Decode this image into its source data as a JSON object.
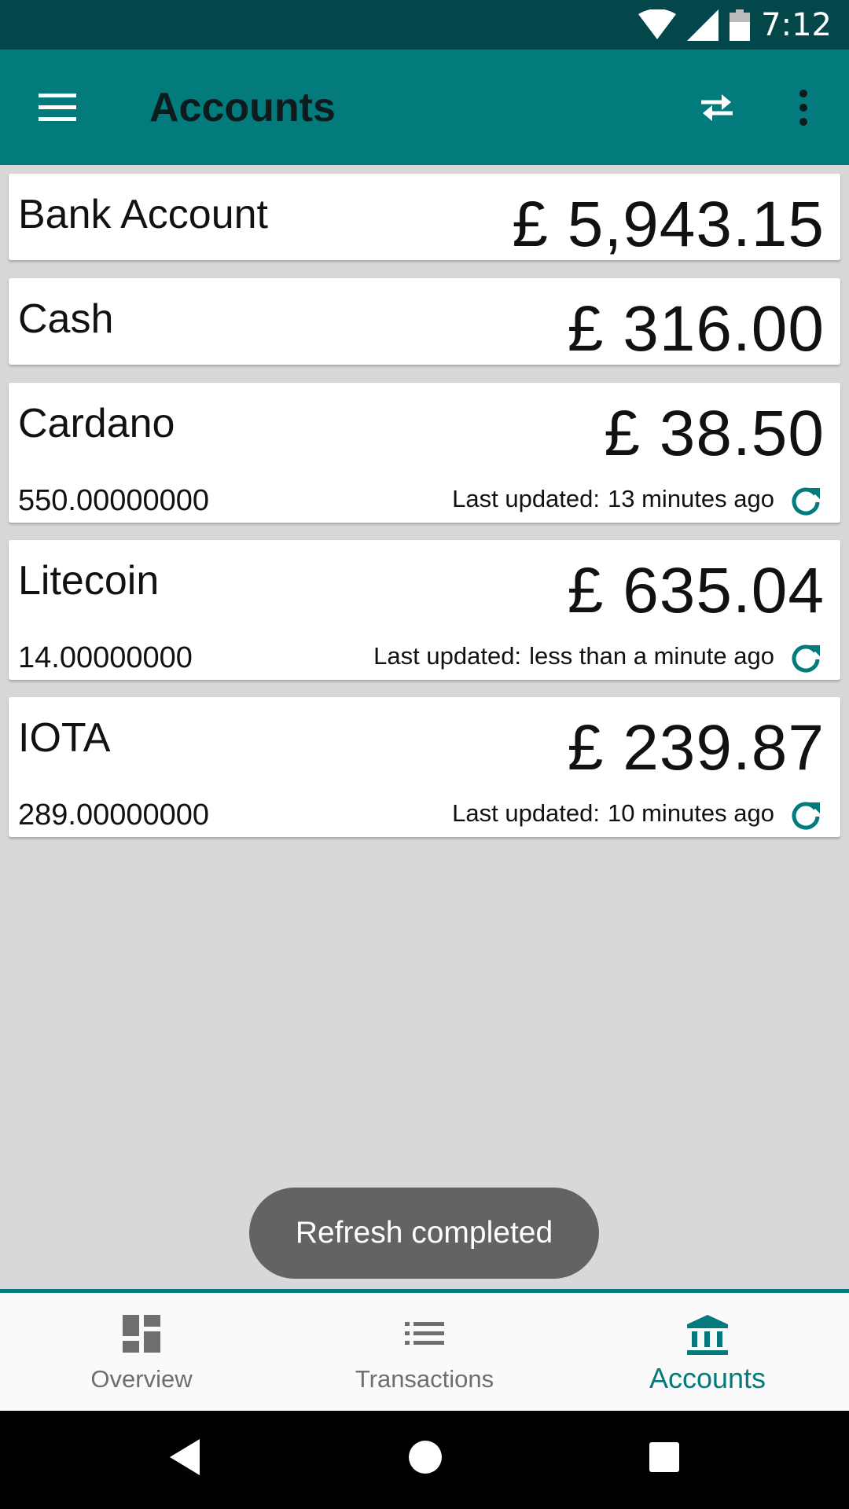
{
  "status_bar": {
    "time": "7:12"
  },
  "app_bar": {
    "title": "Accounts"
  },
  "accounts": [
    {
      "name": "Bank Account",
      "currency_symbol": "£",
      "balance": "5,943.15"
    },
    {
      "name": "Cash",
      "currency_symbol": "£",
      "balance": "316.00"
    },
    {
      "name": "Cardano",
      "currency_symbol": "£",
      "balance": "38.50",
      "quantity": "550.00000000",
      "updated_label": "Last updated:",
      "updated_value": "13 minutes ago"
    },
    {
      "name": "Litecoin",
      "currency_symbol": "£",
      "balance": "635.04",
      "quantity": "14.00000000",
      "updated_label": "Last updated:",
      "updated_value": "less than a minute ago"
    },
    {
      "name": "IOTA",
      "currency_symbol": "£",
      "balance": "239.87",
      "quantity": "289.00000000",
      "updated_label": "Last updated:",
      "updated_value": "10 minutes ago"
    }
  ],
  "toast": {
    "message": "Refresh completed"
  },
  "bottom_nav": {
    "items": [
      {
        "label": "Overview",
        "icon": "dashboard-icon"
      },
      {
        "label": "Transactions",
        "icon": "list-icon"
      },
      {
        "label": "Accounts",
        "icon": "bank-icon",
        "active": true
      }
    ]
  },
  "colors": {
    "primary": "#037a7b",
    "primary_dark": "#04474a",
    "accent": "#037a7b",
    "background": "#d8d8d8",
    "toast": "#636363"
  }
}
